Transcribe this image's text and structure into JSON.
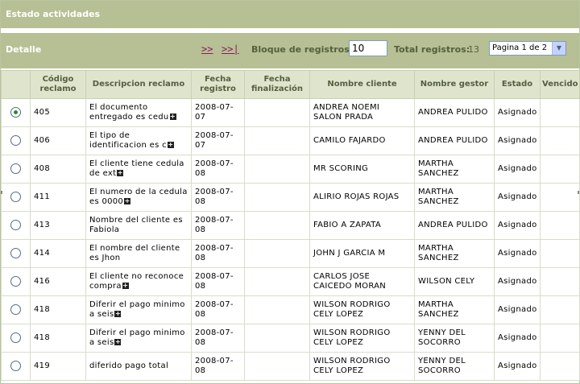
{
  "header": {
    "title": "Estado actividades"
  },
  "toolbar": {
    "detalle_label": "Detalle",
    "next_label": ">>",
    "last_label": ">>|",
    "bloque_label": "Bloque de registros:",
    "bloque_value": "10",
    "total_label": "Total registros:",
    "total_value": "13",
    "page_select_value": "Pagina 1 de 2"
  },
  "table": {
    "columns": [
      "",
      "Código reclamo",
      "Descripcion reclamo",
      "Fecha registro",
      "Fecha finalización",
      "Nombre cliente",
      "Nombre gestor",
      "Estado",
      "Vencido"
    ],
    "rows": [
      {
        "selected": true,
        "codigo": "405",
        "descripcion": "El documento entregado es cedu",
        "has_more": true,
        "fecha_registro": "2008-07-07",
        "fecha_finalizacion": "",
        "cliente": "ANDREA NOEMI SALON PRADA",
        "gestor": "ANDREA PULIDO",
        "estado": "Asignado",
        "vencido": ""
      },
      {
        "selected": false,
        "codigo": "406",
        "descripcion": "El tipo de identificacion es c",
        "has_more": true,
        "fecha_registro": "2008-07-07",
        "fecha_finalizacion": "",
        "cliente": "CAMILO FAJARDO",
        "gestor": "ANDREA PULIDO",
        "estado": "Asignado",
        "vencido": ""
      },
      {
        "selected": false,
        "codigo": "408",
        "descripcion": "El cliente tiene cedula de ext",
        "has_more": true,
        "fecha_registro": "2008-07-08",
        "fecha_finalizacion": "",
        "cliente": "MR SCORING",
        "gestor": "MARTHA SANCHEZ",
        "estado": "Asignado",
        "vencido": ""
      },
      {
        "selected": false,
        "codigo": "411",
        "descripcion": "El numero de la cedula es 0000",
        "has_more": true,
        "fecha_registro": "2008-07-08",
        "fecha_finalizacion": "",
        "cliente": "ALIRIO ROJAS ROJAS",
        "gestor": "MARTHA SANCHEZ",
        "estado": "Asignado",
        "vencido": ""
      },
      {
        "selected": false,
        "codigo": "413",
        "descripcion": "Nombre del cliente es Fabiola",
        "has_more": false,
        "fecha_registro": "2008-07-08",
        "fecha_finalizacion": "",
        "cliente": "FABIO A ZAPATA",
        "gestor": "ANDREA PULIDO",
        "estado": "Asignado",
        "vencido": ""
      },
      {
        "selected": false,
        "codigo": "414",
        "descripcion": "El nombre del cliente es Jhon",
        "has_more": false,
        "fecha_registro": "2008-07-08",
        "fecha_finalizacion": "",
        "cliente": "JOHN J GARCIA M",
        "gestor": "MARTHA SANCHEZ",
        "estado": "Asignado",
        "vencido": ""
      },
      {
        "selected": false,
        "codigo": "416",
        "descripcion": "El cliente no reconoce compra",
        "has_more": true,
        "fecha_registro": "2008-07-08",
        "fecha_finalizacion": "",
        "cliente": "CARLOS JOSE CAICEDO MORAN",
        "gestor": "WILSON CELY",
        "estado": "Asignado",
        "vencido": ""
      },
      {
        "selected": false,
        "codigo": "418",
        "descripcion": "Diferir el pago minimo a seis",
        "has_more": true,
        "fecha_registro": "2008-07-08",
        "fecha_finalizacion": "",
        "cliente": "WILSON RODRIGO CELY LOPEZ",
        "gestor": "MARTHA SANCHEZ",
        "estado": "Asignado",
        "vencido": ""
      },
      {
        "selected": false,
        "codigo": "418",
        "descripcion": "Diferir el pago minimo a seis",
        "has_more": true,
        "fecha_registro": "2008-07-08",
        "fecha_finalizacion": "",
        "cliente": "WILSON RODRIGO CELY LOPEZ",
        "gestor": "YENNY DEL SOCORRO",
        "estado": "Asignado",
        "vencido": ""
      },
      {
        "selected": false,
        "codigo": "419",
        "descripcion": "diferido pago total",
        "has_more": false,
        "fecha_registro": "2008-07-08",
        "fecha_finalizacion": "",
        "cliente": "WILSON RODRIGO CELY LOPEZ",
        "gestor": "YENNY DEL SOCORRO",
        "estado": "Asignado",
        "vencido": ""
      }
    ]
  },
  "colors": {
    "header_bg": "#b6c094",
    "column_header_bg": "#dfe5cd",
    "link": "#8b1a5e"
  },
  "icons": {
    "expand": "plus-box-icon",
    "select_arrow": "chevron-down-icon"
  }
}
